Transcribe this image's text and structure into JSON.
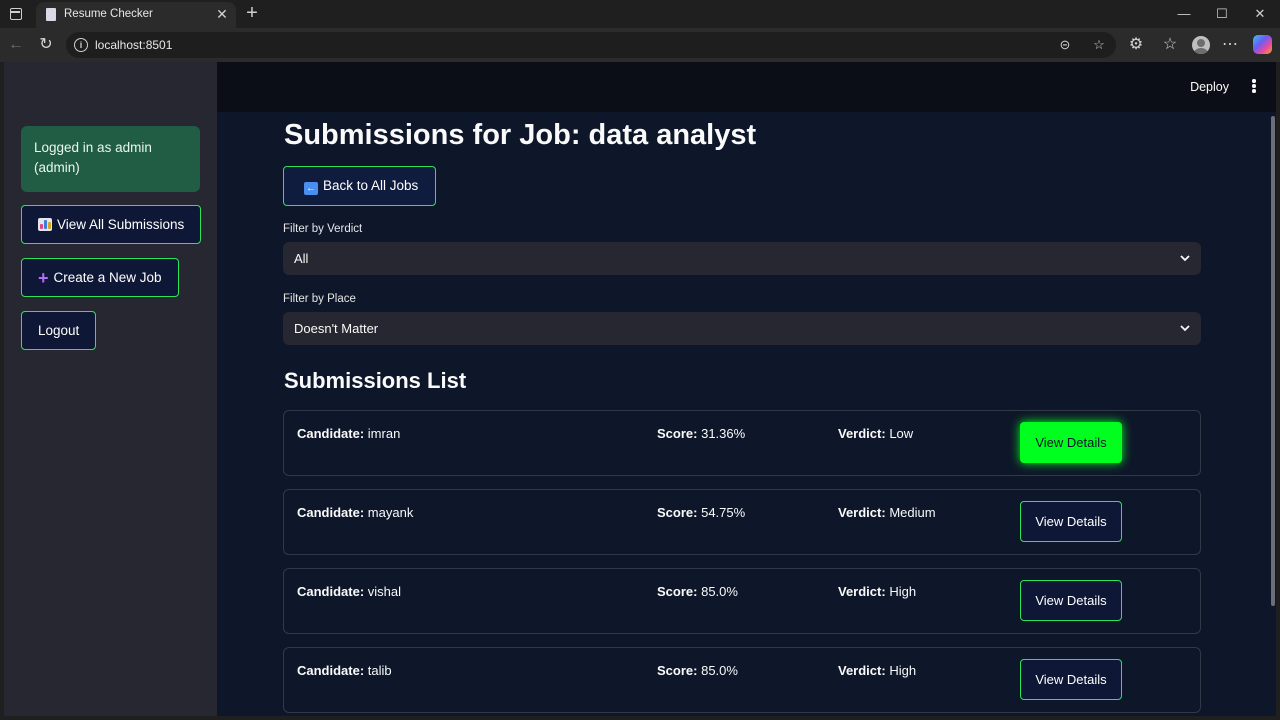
{
  "browser": {
    "tab_title": "Resume Checker",
    "url": "localhost:8501"
  },
  "sidebar": {
    "login_text": "Logged in as admin (admin)",
    "view_all_label": "View All Submissions",
    "create_job_label": "Create a New Job",
    "logout_label": "Logout"
  },
  "header": {
    "deploy_label": "Deploy"
  },
  "main": {
    "title": "Submissions for Job: data analyst",
    "back_label": "Back to All Jobs",
    "filter_verdict": {
      "label": "Filter by Verdict",
      "value": "All"
    },
    "filter_place": {
      "label": "Filter by Place",
      "value": "Doesn't Matter"
    },
    "list_title": "Submissions List",
    "field_labels": {
      "candidate": "Candidate:",
      "score": "Score:",
      "verdict": "Verdict:"
    },
    "view_details_label": "View Details",
    "submissions": [
      {
        "candidate": "imran",
        "score": "31.36%",
        "verdict": "Low"
      },
      {
        "candidate": "mayank",
        "score": "54.75%",
        "verdict": "Medium"
      },
      {
        "candidate": "vishal",
        "score": "85.0%",
        "verdict": "High"
      },
      {
        "candidate": "talib",
        "score": "85.0%",
        "verdict": "High"
      }
    ]
  },
  "colors": {
    "accent_green": "#2ee35c",
    "active_button": "#00ff1e",
    "login_box": "#205d44",
    "background": "#0e1629"
  }
}
